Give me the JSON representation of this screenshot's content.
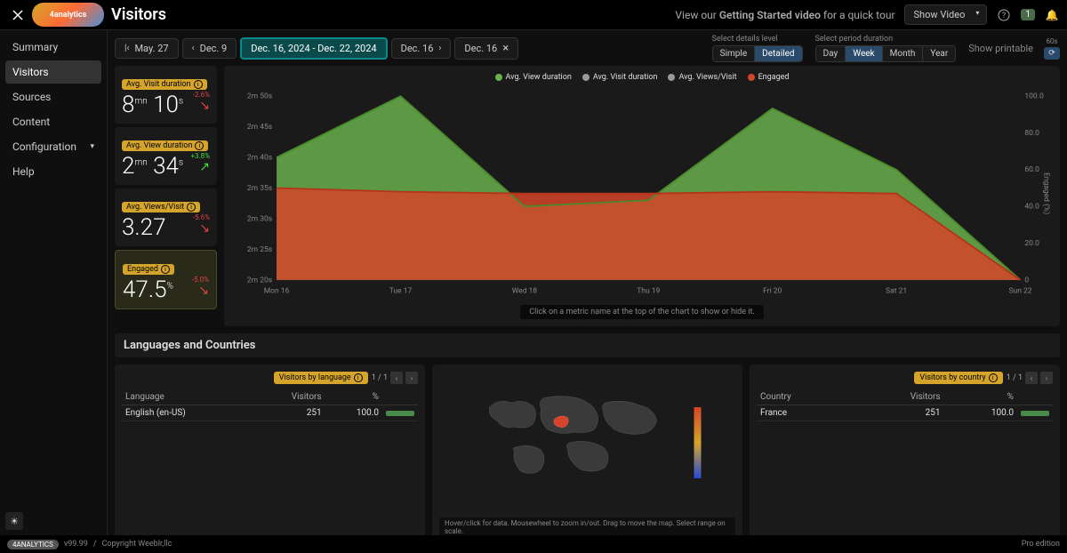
{
  "header": {
    "logo_text": "4analytics",
    "page_title": "Visitors",
    "tour_prefix": "View our ",
    "tour_strong": "Getting Started video",
    "tour_suffix": " for a quick tour",
    "show_video": "Show Video",
    "badge_count": "1"
  },
  "sidebar": {
    "items": [
      {
        "label": "Summary"
      },
      {
        "label": "Visitors"
      },
      {
        "label": "Sources"
      },
      {
        "label": "Content"
      },
      {
        "label": "Configuration"
      },
      {
        "label": "Help"
      }
    ]
  },
  "toolbar": {
    "dates": [
      {
        "label": "May. 27"
      },
      {
        "label": "Dec. 9"
      },
      {
        "label": "Dec. 16, 2024 - Dec. 22, 2024"
      },
      {
        "label": "Dec. 16"
      },
      {
        "label": "Dec. 16"
      }
    ],
    "details_label": "Select details level",
    "details": [
      {
        "label": "Simple"
      },
      {
        "label": "Detailed"
      }
    ],
    "period_label": "Select period duration",
    "periods": [
      {
        "label": "Day"
      },
      {
        "label": "Week"
      },
      {
        "label": "Month"
      },
      {
        "label": "Year"
      }
    ],
    "show_printable": "Show printable",
    "refresh_label": "60s"
  },
  "metrics": [
    {
      "tag": "Avg. Visit duration",
      "value_html": "8<span class='unit'>mn</span> 10<span class='unit'>s</span>",
      "delta": "-2.6%",
      "dir": "neg"
    },
    {
      "tag": "Avg. View duration",
      "value_html": "2<span class='unit'>mn</span> 34<span class='unit'>s</span>",
      "delta": "+3.8%",
      "dir": "pos"
    },
    {
      "tag": "Avg. Views/Visit",
      "value_html": "3.27",
      "delta": "-5.6%",
      "dir": "neg"
    },
    {
      "tag": "Engaged",
      "value_html": "47.5<span class='unit'>%</span>",
      "delta": "-5.0%",
      "dir": "neg",
      "highlight": true
    }
  ],
  "chart": {
    "legend": [
      {
        "label": "Avg. View duration",
        "color": "#6ab04c"
      },
      {
        "label": "Avg. Visit duration",
        "color": "#999"
      },
      {
        "label": "Avg. Views/Visit",
        "color": "#999"
      },
      {
        "label": "Engaged",
        "color": "#d4442a"
      }
    ],
    "hint": "Click on a metric name at the top of the chart to show or hide it."
  },
  "chart_data": {
    "type": "area",
    "x_categories": [
      "Mon 16",
      "Tue 17",
      "Wed 18",
      "Thu 19",
      "Fri 20",
      "Sat 21",
      "Sun 22"
    ],
    "y_left_ticks": [
      "2m 20s",
      "2m 25s",
      "2m 30s",
      "2m 35s",
      "2m 40s",
      "2m 45s",
      "2m 50s"
    ],
    "y_right_ticks": [
      "0",
      "20.0",
      "40.0",
      "60.0",
      "80.0",
      "100.0"
    ],
    "y_right_label": "Engaged (%)",
    "series": [
      {
        "name": "Avg. View duration",
        "color": "#6ab04c",
        "values": [
          160,
          170,
          152,
          153,
          168,
          158,
          0
        ]
      },
      {
        "name": "Engaged",
        "color": "#d4442a",
        "values": [
          50,
          48,
          47,
          47,
          48,
          47,
          0
        ]
      }
    ]
  },
  "section_title": "Languages and Countries",
  "lang_panel": {
    "title": "Visitors by language",
    "pager": "1 / 1",
    "cols": [
      "Language",
      "Visitors",
      "%"
    ],
    "rows": [
      {
        "lang": "English (en-US)",
        "visitors": "251",
        "pct": "100.0"
      }
    ]
  },
  "map_panel": {
    "hint": "Hover/click for data. Mousewheel to zoom in/out. Drag to move the map. Select range on scale."
  },
  "country_panel": {
    "title": "Visitors by country",
    "pager": "1 / 1",
    "cols": [
      "Country",
      "Visitors",
      "%"
    ],
    "rows": [
      {
        "country": "France",
        "visitors": "251",
        "pct": "100.0"
      }
    ]
  },
  "footer": {
    "logo": "4ANALYTICS",
    "version": "v99.99",
    "sep": "/",
    "copyright": "Copyright Weeblr,llc",
    "edition": "Pro edition"
  }
}
